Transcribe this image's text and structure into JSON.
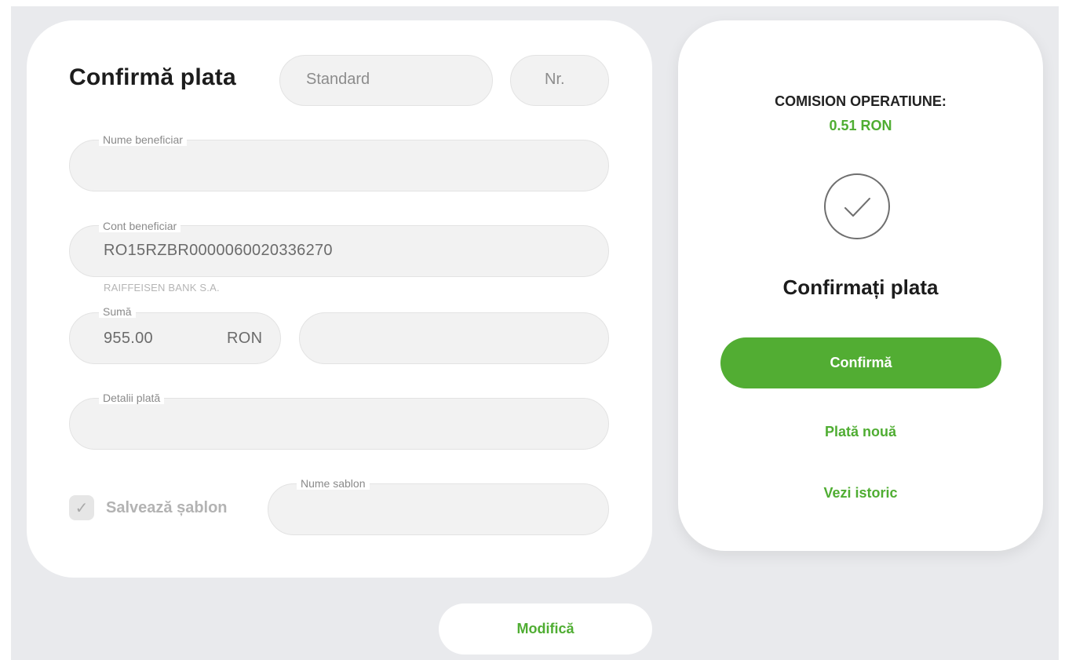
{
  "form": {
    "title": "Confirmă plata",
    "payment_type": "Standard",
    "number_placeholder": "Nr.",
    "beneficiary_name_label": "Nume beneficiar",
    "beneficiary_name_value": "",
    "beneficiary_account_label": "Cont beneficiar",
    "beneficiary_account_value": "RO15RZBR0000060020336270",
    "bank_name": "RAIFFEISEN BANK S.A.",
    "amount_label": "Sumă",
    "amount_value": "955.00",
    "currency": "RON",
    "payment_details_label": "Detalii plată",
    "save_template_label": "Salvează șablon",
    "save_template_checked": true,
    "template_name_label": "Nume sablon"
  },
  "summary": {
    "commission_label": "COMISION OPERATIUNE:",
    "commission_value": "0.51 RON",
    "confirm_title": "Confirmați plata",
    "confirm_button": "Confirmă",
    "new_payment_link": "Plată nouă",
    "history_link": "Vezi istoric"
  },
  "footer": {
    "modify_button": "Modifică"
  },
  "colors": {
    "accent_green": "#52ad33",
    "background": "#e9eaed",
    "card": "#ffffff"
  }
}
